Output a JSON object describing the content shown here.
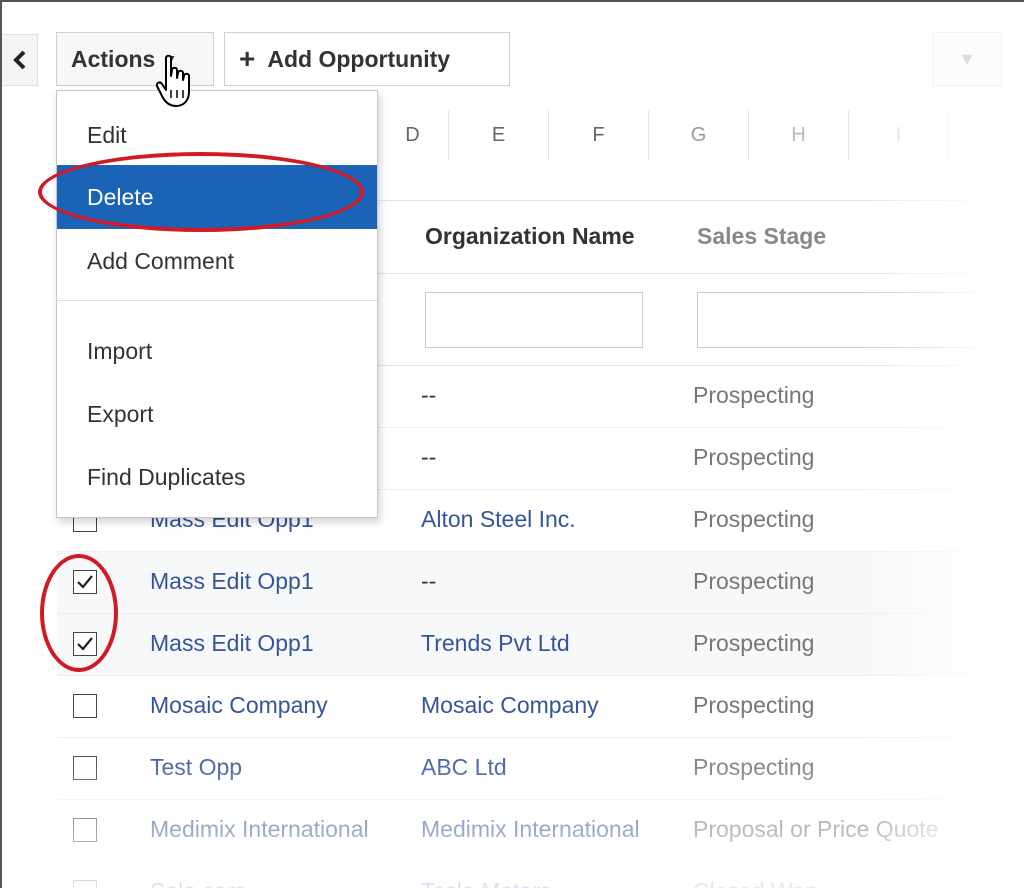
{
  "toolbar": {
    "actions_label": "Actions",
    "add_label": "Add Opportunity"
  },
  "letters": [
    "D",
    "E",
    "F",
    "G",
    "H",
    "I"
  ],
  "table": {
    "columns": [
      "Organization Name",
      "Sales Stage"
    ],
    "rows": [
      {
        "name": "",
        "org": "--",
        "stage": "Prospecting",
        "checked": false
      },
      {
        "name": "",
        "org": "--",
        "stage": "Prospecting",
        "checked": false
      },
      {
        "name": "Mass Edit Opp1",
        "org": "Alton Steel Inc.",
        "stage": "Prospecting",
        "checked": false
      },
      {
        "name": "Mass Edit Opp1",
        "org": "--",
        "stage": "Prospecting",
        "checked": true
      },
      {
        "name": "Mass Edit Opp1",
        "org": "Trends Pvt Ltd",
        "stage": "Prospecting",
        "checked": true
      },
      {
        "name": "Mosaic Company",
        "org": "Mosaic Company",
        "stage": "Prospecting",
        "checked": false
      },
      {
        "name": "Test Opp",
        "org": "ABC Ltd",
        "stage": "Prospecting",
        "checked": false
      },
      {
        "name": "Medimix International",
        "org": "Medimix International",
        "stage": "Proposal or Price Quote",
        "checked": false
      },
      {
        "name": "Sale cars",
        "org": "Tesla Motors",
        "stage": "Closed Won",
        "checked": false
      }
    ]
  },
  "menu": {
    "items": [
      "Edit",
      "Delete",
      "Add Comment",
      "Import",
      "Export",
      "Find Duplicates"
    ],
    "active": "Delete"
  },
  "colors": {
    "accent": "#1a63b6",
    "link": "#33559b",
    "annotation": "#d11a24"
  }
}
